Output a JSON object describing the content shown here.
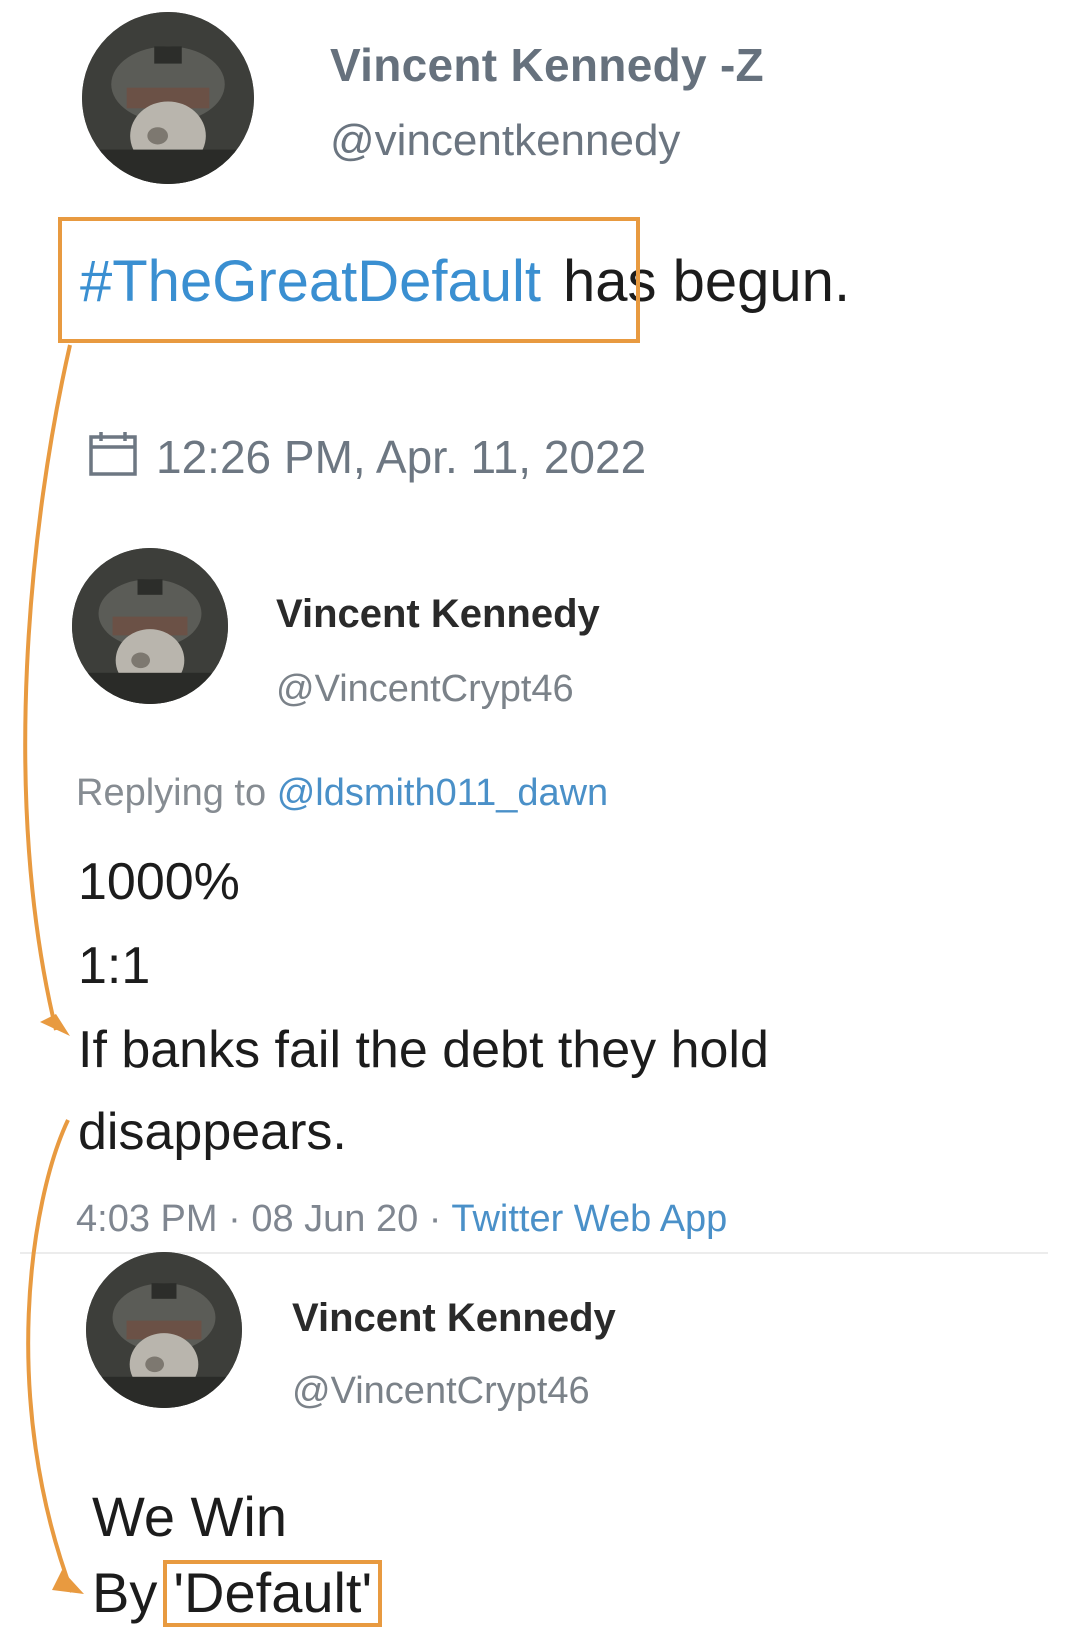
{
  "tweet1": {
    "display_name": "Vincent Kennedy -Z",
    "handle": "@vincentkennedy",
    "hashtag": "#TheGreatDefault",
    "text": "has begun.",
    "timestamp": "12:26 PM, Apr. 11, 2022",
    "date_icon": "calendar-icon"
  },
  "tweet2": {
    "display_name": "Vincent Kennedy",
    "handle": "@VincentCrypt46",
    "replying_label": "Replying to",
    "reply_handle": "@ldsmith011_dawn",
    "lines": [
      "1000%",
      "1:1",
      "If banks fail the debt they hold",
      "disappears."
    ],
    "time": "4:03 PM",
    "date": "08 Jun 20",
    "separator": "·",
    "source": "Twitter Web App"
  },
  "tweet3": {
    "display_name": "Vincent Kennedy",
    "handle": "@VincentCrypt46",
    "line1": "We Win",
    "line2_prefix": "By",
    "line2_quoted": "'Default'"
  },
  "colors": {
    "annotation": "#e89a40",
    "link": "#3a8fd1",
    "muted": "#6d7782"
  }
}
